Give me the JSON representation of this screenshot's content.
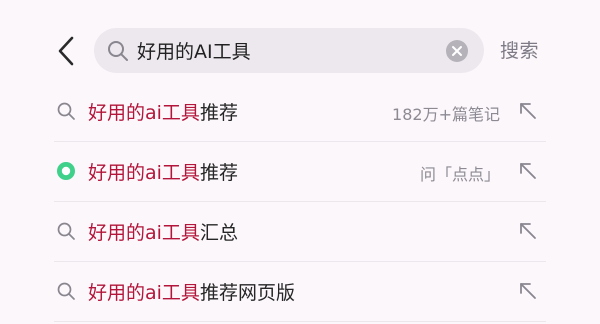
{
  "search": {
    "query": "好用的AI工具",
    "submit_label": "搜索"
  },
  "suggestions": [
    {
      "highlight": "好用的ai工具",
      "rest": "推荐",
      "meta": "182万+篇笔记",
      "icon": "search-icon"
    },
    {
      "highlight": "好用的ai工具",
      "rest": "推荐",
      "meta": "问「点点」",
      "icon": "diandian-ai-icon"
    },
    {
      "highlight": "好用的ai工具",
      "rest": "汇总",
      "meta": "",
      "icon": "search-icon"
    },
    {
      "highlight": "好用的ai工具",
      "rest": "推荐网页版",
      "meta": "",
      "icon": "search-icon"
    }
  ],
  "colors": {
    "highlight": "#b3163a",
    "assistant_green": "#3fd08a"
  }
}
